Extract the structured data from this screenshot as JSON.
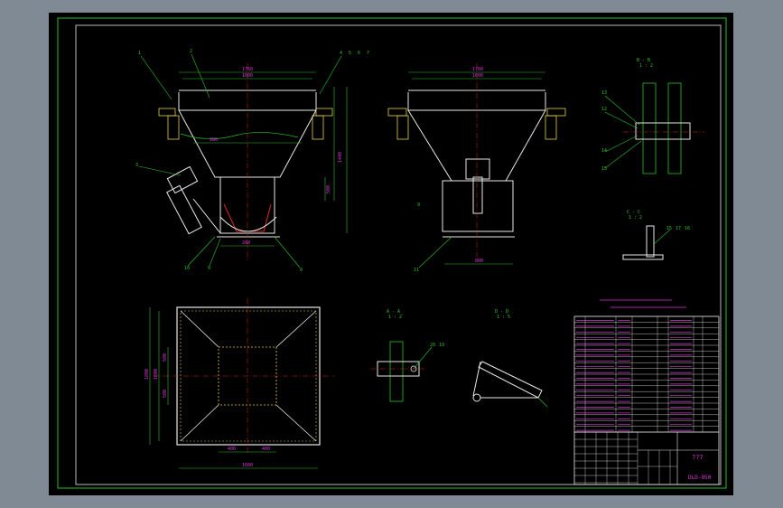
{
  "colors": {
    "screen_bg": "#7f8a94",
    "sheet_bg": "#000000",
    "frame": "#29c229",
    "outline": "#e8e8e8",
    "dimension": "#29c229",
    "text": "#e033e0",
    "center_line": "#e02424"
  },
  "front_view": {
    "dim_top": "1760",
    "dim_top2": "1600",
    "dim_mid": "980",
    "dim_lower": "530",
    "dim_height": "1440",
    "dim_b": "500",
    "dim_c": "280",
    "dim_bottom": "280",
    "callouts_top_left": [
      "1",
      "2"
    ],
    "callouts_top_right": [
      "4",
      "5",
      "6",
      "7"
    ],
    "callout_left": "3",
    "callout_bottom_left": [
      "10",
      "9"
    ],
    "callout_bottom_right": "8"
  },
  "side_view": {
    "dim_top": "1760",
    "dim_top2": "1600",
    "dim_bottom": "800",
    "callout_bottom": "11",
    "callout_left": "9"
  },
  "section_bb": {
    "title": "B - B",
    "scale": "1 : 2",
    "callouts": [
      "13",
      "12",
      "14",
      "15"
    ]
  },
  "section_cc": {
    "title": "C - C",
    "scale": "1 : 2",
    "callouts": [
      "15",
      "17",
      "16"
    ]
  },
  "section_aa": {
    "title": "A - A",
    "scale": "1 : 2",
    "callouts": [
      "20",
      "19"
    ]
  },
  "section_dd": {
    "title": "D - D",
    "scale": "1 : 5"
  },
  "plan_view": {
    "dim_height": "1800",
    "dim_inner": "1600",
    "dim_left_a": "500",
    "dim_left_b": "500",
    "dim_bottom_a": "400",
    "dim_bottom_b": "400",
    "dim_bottom": "1600"
  },
  "title_block": {
    "drawing_name": "???",
    "drawing_code": "DLD-050"
  }
}
